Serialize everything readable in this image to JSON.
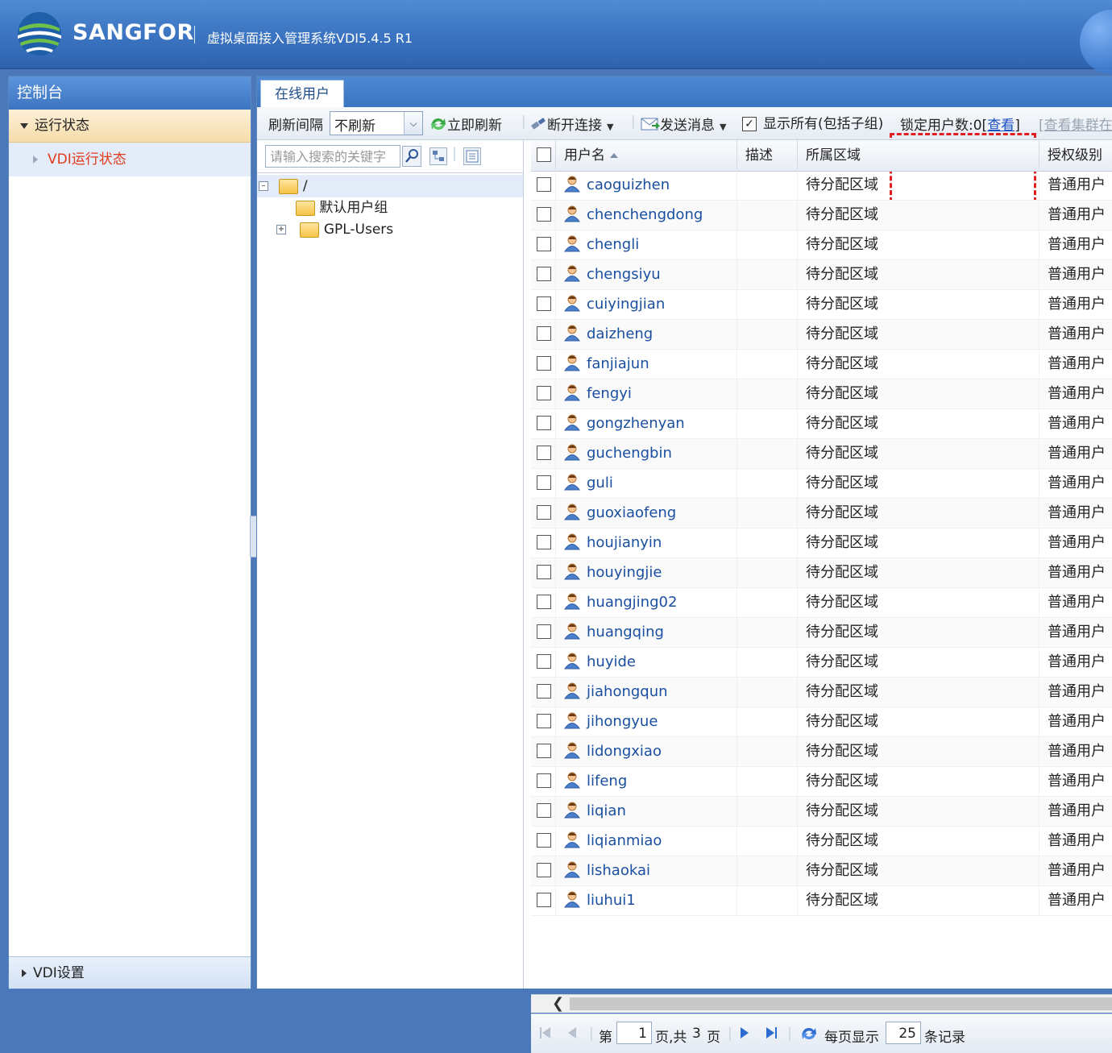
{
  "header": {
    "brand": "SANGFOR",
    "product": "虚拟桌面接入管理系统VDI5.4.5 R1"
  },
  "left": {
    "title": "控制台",
    "section": "运行状态",
    "item": "VDI运行状态",
    "bottom": "VDI设置"
  },
  "tab": "在线用户",
  "toolbar": {
    "refresh_label": "刷新间隔",
    "refresh_value": "不刷新",
    "refresh_now": "立即刷新",
    "disconnect": "断开连接",
    "send_message": "发送消息",
    "show_all": "显示所有(包括子组)",
    "show_all_checked": true,
    "locked_prefix": "锁定用户数:0[",
    "locked_link": "查看",
    "locked_suffix": "]",
    "cluster_prefix": "[",
    "cluster_link": "查看集群在"
  },
  "tree": {
    "search_placeholder": "请输入搜索的关键字",
    "root": "/",
    "children": [
      "默认用户组",
      "GPL-Users"
    ]
  },
  "grid": {
    "columns": [
      "用户名",
      "描述",
      "所属区域",
      "授权级别"
    ],
    "rows": [
      {
        "user": "caoguizhen",
        "desc": "",
        "region": "待分配区域",
        "level": "普通用户"
      },
      {
        "user": "chenchengdong",
        "desc": "",
        "region": "待分配区域",
        "level": "普通用户"
      },
      {
        "user": "chengli",
        "desc": "",
        "region": "待分配区域",
        "level": "普通用户"
      },
      {
        "user": "chengsiyu",
        "desc": "",
        "region": "待分配区域",
        "level": "普通用户"
      },
      {
        "user": "cuiyingjian",
        "desc": "",
        "region": "待分配区域",
        "level": "普通用户"
      },
      {
        "user": "daizheng",
        "desc": "",
        "region": "待分配区域",
        "level": "普通用户"
      },
      {
        "user": "fanjiajun",
        "desc": "",
        "region": "待分配区域",
        "level": "普通用户"
      },
      {
        "user": "fengyi",
        "desc": "",
        "region": "待分配区域",
        "level": "普通用户"
      },
      {
        "user": "gongzhenyan",
        "desc": "",
        "region": "待分配区域",
        "level": "普通用户"
      },
      {
        "user": "guchengbin",
        "desc": "",
        "region": "待分配区域",
        "level": "普通用户"
      },
      {
        "user": "guli",
        "desc": "",
        "region": "待分配区域",
        "level": "普通用户"
      },
      {
        "user": "guoxiaofeng",
        "desc": "",
        "region": "待分配区域",
        "level": "普通用户"
      },
      {
        "user": "houjianyin",
        "desc": "",
        "region": "待分配区域",
        "level": "普通用户"
      },
      {
        "user": "houyingjie",
        "desc": "",
        "region": "待分配区域",
        "level": "普通用户"
      },
      {
        "user": "huangjing02",
        "desc": "",
        "region": "待分配区域",
        "level": "普通用户"
      },
      {
        "user": "huangqing",
        "desc": "",
        "region": "待分配区域",
        "level": "普通用户"
      },
      {
        "user": "huyide",
        "desc": "",
        "region": "待分配区域",
        "level": "普通用户"
      },
      {
        "user": "jiahongqun",
        "desc": "",
        "region": "待分配区域",
        "level": "普通用户"
      },
      {
        "user": "jihongyue",
        "desc": "",
        "region": "待分配区域",
        "level": "普通用户"
      },
      {
        "user": "lidongxiao",
        "desc": "",
        "region": "待分配区域",
        "level": "普通用户"
      },
      {
        "user": "lifeng",
        "desc": "",
        "region": "待分配区域",
        "level": "普通用户"
      },
      {
        "user": "liqian",
        "desc": "",
        "region": "待分配区域",
        "level": "普通用户"
      },
      {
        "user": "liqianmiao",
        "desc": "",
        "region": "待分配区域",
        "level": "普通用户"
      },
      {
        "user": "lishaokai",
        "desc": "",
        "region": "待分配区域",
        "level": "普通用户"
      },
      {
        "user": "liuhui1",
        "desc": "",
        "region": "待分配区域",
        "level": "普通用户"
      }
    ]
  },
  "pager": {
    "page_prefix": "第",
    "page": "1",
    "page_mid": "页,共",
    "total_pages": "3",
    "page_suffix": "页",
    "per_page_label": "每页显示",
    "per_page": "25",
    "records_label": "条记录"
  }
}
